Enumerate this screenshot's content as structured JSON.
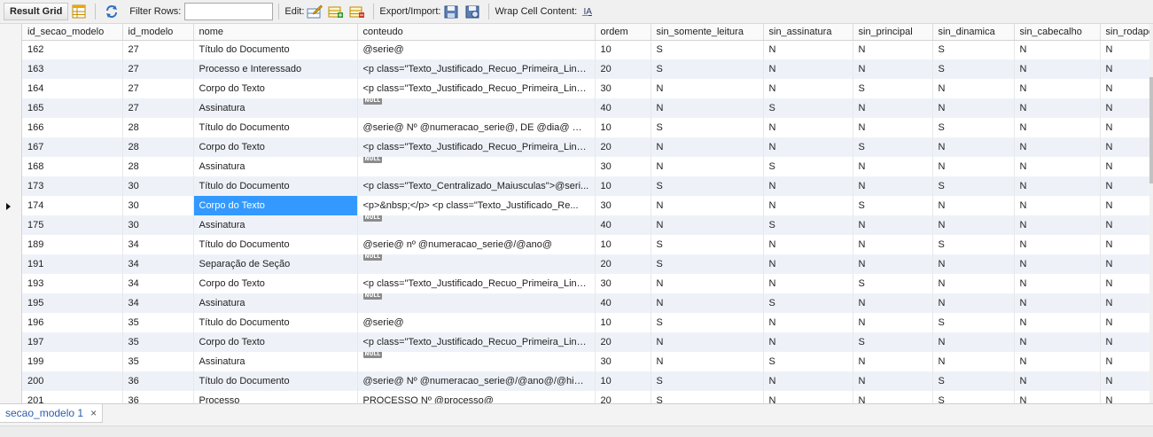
{
  "toolbar": {
    "result_grid": "Result Grid",
    "filter_rows": "Filter Rows:",
    "filter_value": "",
    "edit": "Edit:",
    "export_import": "Export/Import:",
    "wrap_cell": "Wrap Cell Content:",
    "wrap_icon_text": "I̲A"
  },
  "columns": [
    "id_secao_modelo",
    "id_modelo",
    "nome",
    "conteudo",
    "ordem",
    "sin_somente_leitura",
    "sin_assinatura",
    "sin_principal",
    "sin_dinamica",
    "sin_cabecalho",
    "sin_rodape"
  ],
  "null_label": "NULL",
  "rows": [
    [
      "162",
      "27",
      "Título do Documento",
      "@serie@",
      "10",
      "S",
      "N",
      "N",
      "S",
      "N",
      "N"
    ],
    [
      "163",
      "27",
      "Processo e Interessado",
      "<p class=\"Texto_Justificado_Recuo_Primeira_Linh...",
      "20",
      "S",
      "N",
      "N",
      "S",
      "N",
      "N"
    ],
    [
      "164",
      "27",
      "Corpo do Texto",
      "<p class=\"Texto_Justificado_Recuo_Primeira_Linh...",
      "30",
      "N",
      "N",
      "S",
      "N",
      "N",
      "N"
    ],
    [
      "165",
      "27",
      "Assinatura",
      null,
      "40",
      "N",
      "S",
      "N",
      "N",
      "N",
      "N"
    ],
    [
      "166",
      "28",
      "Título do Documento",
      "@serie@ Nº @numeracao_serie@, DE @dia@ DE ...",
      "10",
      "S",
      "N",
      "N",
      "S",
      "N",
      "N"
    ],
    [
      "167",
      "28",
      "Corpo do Texto",
      "<p class=\"Texto_Justificado_Recuo_Primeira_Linh...",
      "20",
      "N",
      "N",
      "S",
      "N",
      "N",
      "N"
    ],
    [
      "168",
      "28",
      "Assinatura",
      null,
      "30",
      "N",
      "S",
      "N",
      "N",
      "N",
      "N"
    ],
    [
      "173",
      "30",
      "Título do Documento",
      "<p class=\"Texto_Centralizado_Maiusculas\">@seri...",
      "10",
      "S",
      "N",
      "N",
      "S",
      "N",
      "N"
    ],
    [
      "174",
      "30",
      "Corpo do Texto",
      "<p>&nbsp;</p>  <p class=\"Texto_Justificado_Re...",
      "30",
      "N",
      "N",
      "S",
      "N",
      "N",
      "N"
    ],
    [
      "175",
      "30",
      "Assinatura",
      null,
      "40",
      "N",
      "S",
      "N",
      "N",
      "N",
      "N"
    ],
    [
      "189",
      "34",
      "Título do Documento",
      "@serie@ nº @numeracao_serie@/@ano@",
      "10",
      "S",
      "N",
      "N",
      "S",
      "N",
      "N"
    ],
    [
      "191",
      "34",
      "Separação de Seção",
      null,
      "20",
      "S",
      "N",
      "N",
      "N",
      "N",
      "N"
    ],
    [
      "193",
      "34",
      "Corpo do Texto",
      "<p class=\"Texto_Justificado_Recuo_Primeira_Linh...",
      "30",
      "N",
      "N",
      "S",
      "N",
      "N",
      "N"
    ],
    [
      "195",
      "34",
      "Assinatura",
      null,
      "40",
      "N",
      "S",
      "N",
      "N",
      "N",
      "N"
    ],
    [
      "196",
      "35",
      "Título do Documento",
      "@serie@",
      "10",
      "S",
      "N",
      "N",
      "S",
      "N",
      "N"
    ],
    [
      "197",
      "35",
      "Corpo do Texto",
      "<p class=\"Texto_Justificado_Recuo_Primeira_Linh...",
      "20",
      "N",
      "N",
      "S",
      "N",
      "N",
      "N"
    ],
    [
      "199",
      "35",
      "Assinatura",
      null,
      "30",
      "N",
      "S",
      "N",
      "N",
      "N",
      "N"
    ],
    [
      "200",
      "36",
      "Título do Documento",
      "@serie@ Nº @numeracao_serie@/@ano@/@hiera...",
      "10",
      "S",
      "N",
      "N",
      "S",
      "N",
      "N"
    ],
    [
      "201",
      "36",
      "Processo",
      "PROCESSO Nº @processo@",
      "20",
      "S",
      "N",
      "N",
      "S",
      "N",
      "N"
    ]
  ],
  "selection": {
    "row": 8,
    "col": 2
  },
  "tab": {
    "label": "secao_modelo 1",
    "close": "×"
  }
}
